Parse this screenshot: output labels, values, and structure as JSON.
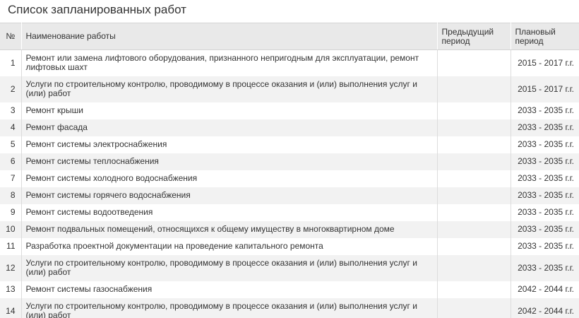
{
  "title": "Список запланированных работ",
  "table": {
    "headers": {
      "num": "№",
      "name": "Наименование работы",
      "previous_period": "Предыдущий период",
      "planned_period": "Плановый период"
    },
    "rows": [
      {
        "num": "1",
        "name": "Ремонт или замена лифтового оборудования, признанного непригодным для эксплуатации, ремонт лифтовых шахт",
        "previous_period": "",
        "planned_period": "2015 - 2017 г.г."
      },
      {
        "num": "2",
        "name": "Услуги по строительному контролю, проводимому в процессе оказания и (или) выполнения услуг и (или) работ",
        "previous_period": "",
        "planned_period": "2015 - 2017 г.г."
      },
      {
        "num": "3",
        "name": "Ремонт крыши",
        "previous_period": "",
        "planned_period": "2033 - 2035 г.г."
      },
      {
        "num": "4",
        "name": "Ремонт фасада",
        "previous_period": "",
        "planned_period": "2033 - 2035 г.г."
      },
      {
        "num": "5",
        "name": "Ремонт системы электроснабжения",
        "previous_period": "",
        "planned_period": "2033 - 2035 г.г."
      },
      {
        "num": "6",
        "name": "Ремонт системы теплоснабжения",
        "previous_period": "",
        "planned_period": "2033 - 2035 г.г."
      },
      {
        "num": "7",
        "name": "Ремонт системы холодного водоснабжения",
        "previous_period": "",
        "planned_period": "2033 - 2035 г.г."
      },
      {
        "num": "8",
        "name": "Ремонт системы горячего водоснабжения",
        "previous_period": "",
        "planned_period": "2033 - 2035 г.г."
      },
      {
        "num": "9",
        "name": "Ремонт системы водоотведения",
        "previous_period": "",
        "planned_period": "2033 - 2035 г.г."
      },
      {
        "num": "10",
        "name": "Ремонт подвальных помещений, относящихся к общему имуществу в многоквартирном доме",
        "previous_period": "",
        "planned_period": "2033 - 2035 г.г."
      },
      {
        "num": "11",
        "name": "Разработка проектной документации на проведение капитального ремонта",
        "previous_period": "",
        "planned_period": "2033 - 2035 г.г."
      },
      {
        "num": "12",
        "name": "Услуги по строительному контролю, проводимому в процессе оказания и (или) выполнения услуг и (или) работ",
        "previous_period": "",
        "planned_period": "2033 - 2035 г.г."
      },
      {
        "num": "13",
        "name": "Ремонт системы газоснабжения",
        "previous_period": "",
        "planned_period": "2042 - 2044 г.г."
      },
      {
        "num": "14",
        "name": "Услуги по строительному контролю, проводимому в процессе оказания и (или) выполнения услуг и (или) работ",
        "previous_period": "",
        "planned_period": "2042 - 2044 г.г."
      }
    ]
  }
}
